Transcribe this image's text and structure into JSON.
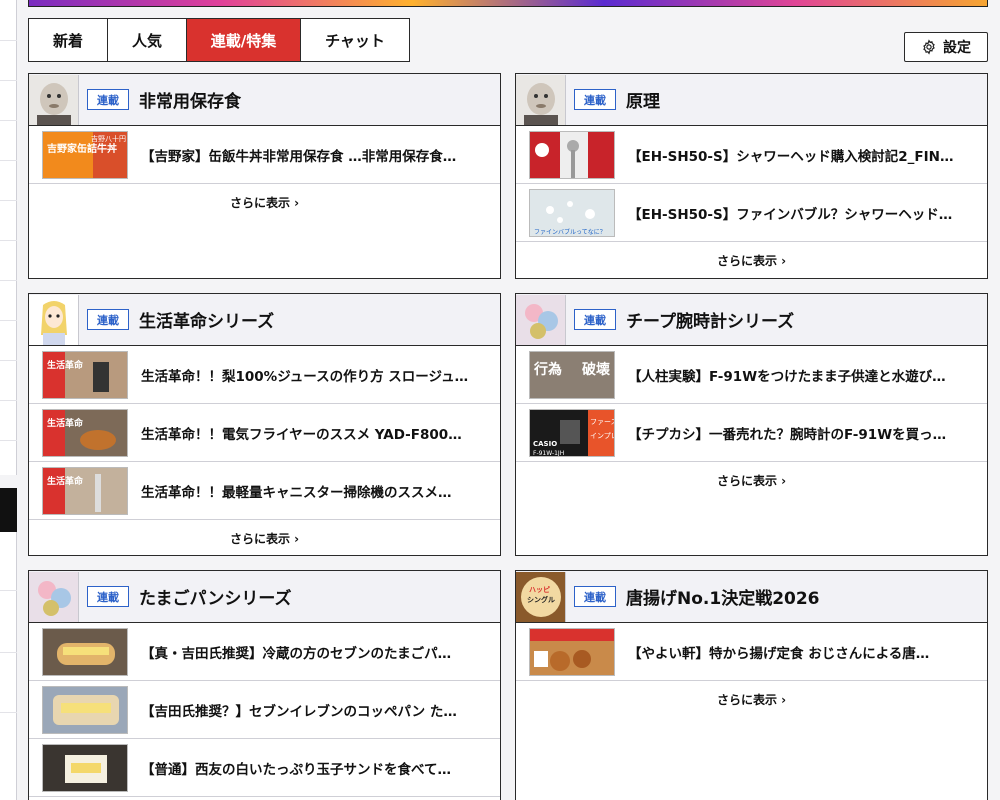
{
  "tabs": [
    {
      "label": "新着",
      "active": false
    },
    {
      "label": "人気",
      "active": false
    },
    {
      "label": "連載/特集",
      "active": true
    },
    {
      "label": "チャット",
      "active": false
    }
  ],
  "settings_label": "設定",
  "more_label": "さらに表示 ›",
  "badge_label": "連載",
  "colors": {
    "accent": "#d9322e",
    "badge": "#2d62c9"
  },
  "cards": [
    {
      "title": "非常用保存食",
      "items": [
        "【吉野家】缶飯牛丼非常用保存食 …非常用保存食…"
      ]
    },
    {
      "title": "原理",
      "items": [
        "【EH-SH50-S】シャワーヘッド購入検討記2_FIN…",
        "【EH-SH50-S】ファインバブル？シャワーヘッド…"
      ]
    },
    {
      "title": "生活革命シリーズ",
      "items": [
        "生活革命！！梨100%ジュースの作り方 スロージュ…",
        "生活革命！！電気フライヤーのススメ YAD-F800…",
        "生活革命！！最軽量キャニスター掃除機のススメ…"
      ]
    },
    {
      "title": "チープ腕時計シリーズ",
      "items": [
        "【人柱実験】F-91Wをつけたまま子供達と水遊び…",
        "【チプカシ】一番売れた？腕時計のF-91Wを買っ…"
      ]
    },
    {
      "title": "たまごパンシリーズ",
      "items": [
        "【真・吉田氏推奨】冷蔵の方のセブンのたまごパ…",
        "【吉田氏推奨？】セブンイレブンのコッペパン た…",
        "【普通】西友の白いたっぷり玉子サンドを食べて…"
      ]
    },
    {
      "title": "唐揚げNo.1決定戦2026",
      "items": [
        "【やよい軒】特から揚げ定食 おじさんによる唐…"
      ]
    }
  ],
  "thumb_text": {
    "yoshinoya": "吉野家缶詰牛丼",
    "yoshinoya_top": "吉野八十円",
    "lifestyle": "生活革命",
    "destroy": "破壊",
    "act": "行為",
    "first": "ファースト",
    "impre": "インプレ",
    "casio": "CASIO",
    "model": "F-91W-1JH",
    "fine_bubble": "ファインバブルってなに？",
    "happy": "ハッピ",
    "single": "シングル"
  }
}
